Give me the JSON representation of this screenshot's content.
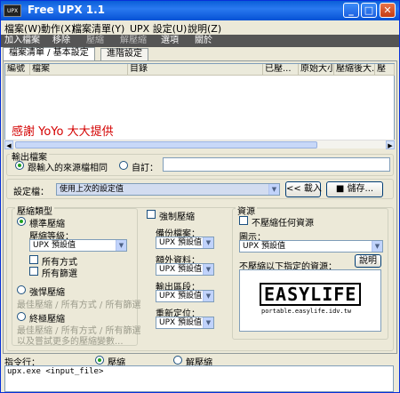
{
  "window": {
    "title": "Free UPX 1.1",
    "app_icon": "UPX"
  },
  "menu": [
    "檔案(W)",
    "動作(X)",
    "檔案清單(Y)",
    "UPX 設定(U)",
    "說明(Z)"
  ],
  "toolbar": [
    "加入檔案",
    "移除",
    "壓縮",
    "解壓縮",
    "選項",
    "關於"
  ],
  "tabs": [
    "檔案清單 / 基本設定",
    "進階設定"
  ],
  "filelist": {
    "columns": [
      "編號",
      "檔案",
      "目錄",
      "已壓...",
      "原始大小",
      "壓縮後大...",
      "壓"
    ],
    "credit": "感謝 YoYo 大大提供"
  },
  "output": {
    "group_label": "輸出檔案",
    "same_as_source": "跟輸入的來源檔相同",
    "custom": "自訂："
  },
  "settings_file": {
    "label": "設定檔：",
    "value": "使用上次的設定值",
    "load_button": "<< 載入",
    "save_button": "儲存..."
  },
  "compress_type": {
    "group_label": "壓縮類型",
    "standard": "標準壓縮",
    "level_label": "壓縮等級：",
    "level_value": "UPX 預設值",
    "all_methods": "所有方式",
    "all_filters": "所有篩選",
    "strong": "強悍壓縮",
    "strong_desc": "最佳壓縮 / 所有方式 / 所有篩選",
    "ultimate": "終極壓縮",
    "ultimate_desc1": "最佳壓縮 / 所有方式 / 所有篩選",
    "ultimate_desc2": "以及嘗試更多的壓縮變數..."
  },
  "middle": {
    "force": "強制壓縮",
    "backup_label": "備份檔案：",
    "backup_value": "UPX 預設值",
    "extra_label": "額外資料：",
    "extra_value": "UPX 預設值",
    "section_label": "輸出區段：",
    "section_value": "UPX 預設值",
    "reloc_label": "重新定位：",
    "reloc_value": "UPX 預設值"
  },
  "resources": {
    "group_label": "資源",
    "no_compress": "不壓縮任何資源",
    "icon_label": "圖示：",
    "icon_value": "UPX 預設值",
    "specified_label": "不壓縮以下指定的資源：",
    "help_button": "說明",
    "logo_big": "EASYLIFE",
    "logo_small": "portable.easylife.idv.tw"
  },
  "command": {
    "label": "指令行：",
    "compress": "壓縮",
    "decompress": "解壓縮",
    "text": "upx.exe <input_file>"
  }
}
